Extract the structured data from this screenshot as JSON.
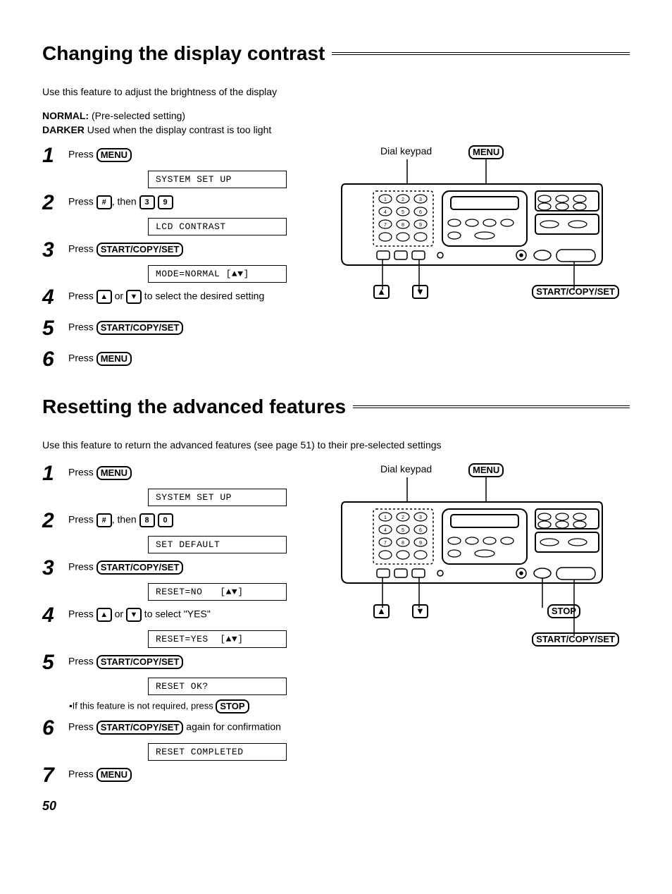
{
  "page_number": "50",
  "section1": {
    "title": "Changing the display contrast",
    "intro": "Use this feature to adjust the brightness of the display",
    "setting_normal_label": "NORMAL:",
    "setting_normal_text": "(Pre-selected setting)",
    "setting_darker_label": "DARKER",
    "setting_darker_text": "Used when the display contrast is too light",
    "steps": [
      {
        "num": "1",
        "pre": "Press ",
        "btn": "MENU",
        "lcd": "SYSTEM SET UP"
      },
      {
        "num": "2",
        "pre": "Press ",
        "k1": "#",
        "mid": ", then ",
        "k2": "3",
        "k3": "9",
        "lcd": "LCD CONTRAST"
      },
      {
        "num": "3",
        "pre": "Press ",
        "btn": "START/COPY/SET",
        "lcd": "MODE=NORMAL [▲▼]"
      },
      {
        "num": "4",
        "pre": "Press ",
        "k1": "▲",
        "mid": " or ",
        "k2": "▼",
        "post": " to select the desired setting"
      },
      {
        "num": "5",
        "pre": "Press ",
        "btn": "START/COPY/SET"
      },
      {
        "num": "6",
        "pre": "Press ",
        "btn": "MENU"
      }
    ],
    "diag": {
      "dial_keypad": "Dial keypad",
      "menu": "MENU",
      "up": "▲",
      "down": "▼",
      "right": "START/COPY/SET"
    }
  },
  "section2": {
    "title": "Resetting the advanced features",
    "intro": "Use this feature to return the advanced features (see page 51) to their pre-selected settings",
    "steps": [
      {
        "num": "1",
        "pre": "Press ",
        "btn": "MENU",
        "lcd": "SYSTEM SET UP"
      },
      {
        "num": "2",
        "pre": "Press ",
        "k1": "#",
        "mid": ", then ",
        "k2": "8",
        "k3": "0",
        "lcd": "SET DEFAULT"
      },
      {
        "num": "3",
        "pre": "Press ",
        "btn": "START/COPY/SET",
        "lcd": "RESET=NO   [▲▼]"
      },
      {
        "num": "4",
        "pre": "Press ",
        "k1": "▲",
        "mid": " or ",
        "k2": "▼",
        "post": " to select \"YES\"",
        "lcd": "RESET=YES  [▲▼]"
      },
      {
        "num": "5",
        "pre": "Press ",
        "btn": "START/COPY/SET",
        "lcd": "RESET OK?"
      },
      {
        "num": "6",
        "pre": "Press ",
        "btn": "START/COPY/SET",
        "post": " again for confirmation",
        "lcd": "RESET COMPLETED"
      },
      {
        "num": "7",
        "pre": "Press ",
        "btn": "MENU"
      }
    ],
    "note_pre": "▪If this feature is not required, press ",
    "note_btn": "STOP",
    "diag": {
      "dial_keypad": "Dial keypad",
      "menu": "MENU",
      "up": "▲",
      "down": "▼",
      "stop": "STOP",
      "right": "START/COPY/SET"
    }
  }
}
